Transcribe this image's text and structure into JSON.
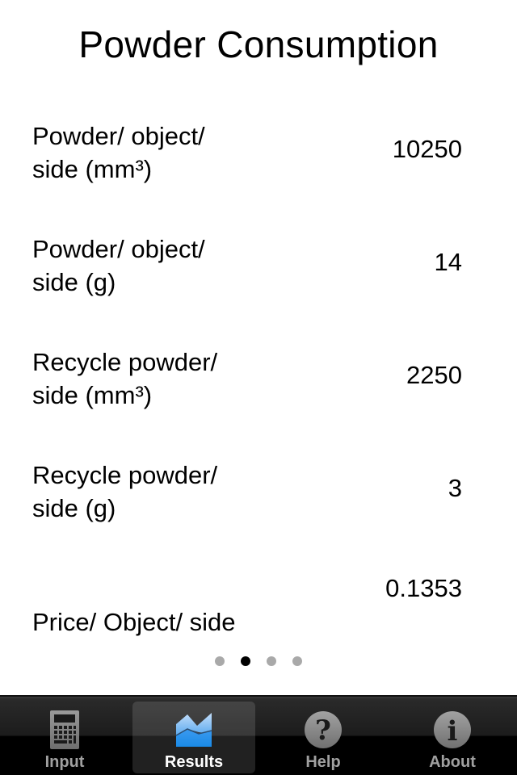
{
  "page": {
    "title": "Powder Consumption"
  },
  "results": [
    {
      "label": "Powder/ object/\nside (mm³)",
      "value": "10250"
    },
    {
      "label": "Powder/ object/\nside (g)",
      "value": "14"
    },
    {
      "label": "Recycle powder/\nside (mm³)",
      "value": "2250"
    },
    {
      "label": "Recycle powder/\nside (g)",
      "value": "3"
    },
    {
      "label": "Price/ Object/ side",
      "value": "0.1353"
    }
  ],
  "pager": {
    "total_pages": 4,
    "current_page": 2
  },
  "tabbar": {
    "tabs": [
      {
        "label": "Input",
        "icon": "calculator-icon",
        "selected": false
      },
      {
        "label": "Results",
        "icon": "area-chart-icon",
        "selected": true
      },
      {
        "label": "Help",
        "icon": "question-icon",
        "selected": false
      },
      {
        "label": "About",
        "icon": "info-icon",
        "selected": false
      }
    ]
  },
  "colors": {
    "selected_icon": "#3ea3f0",
    "inactive_icon": "#8a8a8a",
    "dot_inactive": "#a9a9a9",
    "dot_active": "#000000"
  }
}
